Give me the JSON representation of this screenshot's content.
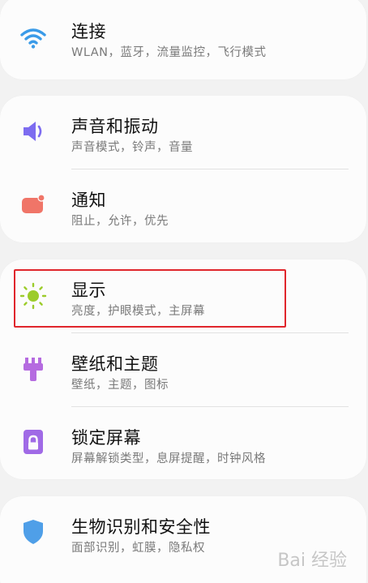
{
  "connections": {
    "title": "连接",
    "subtitle": "WLAN，蓝牙，流量监控，飞行模式",
    "icon": "wifi-icon"
  },
  "sound": {
    "title": "声音和振动",
    "subtitle": "声音模式，铃声，音量",
    "icon": "speaker-icon"
  },
  "notifications": {
    "title": "通知",
    "subtitle": "阻止，允许，优先",
    "icon": "notification-badge-icon"
  },
  "display": {
    "title": "显示",
    "subtitle": "亮度，护眼模式，主屏幕",
    "icon": "sun-brightness-icon"
  },
  "wallpaper": {
    "title": "壁纸和主题",
    "subtitle": "壁纸，主题，图标",
    "icon": "paintbrush-icon"
  },
  "lockscreen": {
    "title": "锁定屏幕",
    "subtitle": "屏幕解锁类型，息屏提醒，时钟风格",
    "icon": "lock-icon"
  },
  "biometrics": {
    "title": "生物识别和安全性",
    "subtitle": "面部识别，虹膜，隐私权",
    "icon": "shield-icon"
  },
  "colors": {
    "wifi": "#3a9be8",
    "speaker": "#7d6cf0",
    "notification": "#f07568",
    "sun": "#9ccc2a",
    "brush": "#b56be0",
    "lock": "#a06ae6",
    "shield": "#4f9fe8",
    "highlight": "#e0262c"
  },
  "watermark": {
    "text": "Bai 经验"
  }
}
